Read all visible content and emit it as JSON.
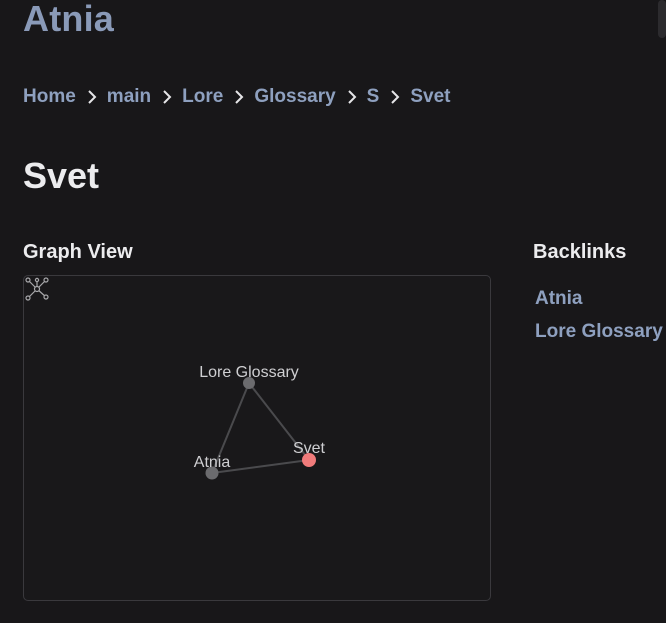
{
  "site": {
    "title": "Atnia"
  },
  "breadcrumb": [
    "Home",
    "main",
    "Lore",
    "Glossary",
    "S",
    "Svet"
  ],
  "page": {
    "title": "Svet"
  },
  "graph": {
    "heading": "Graph View",
    "nodes": [
      {
        "label": "Lore Glossary",
        "current": false
      },
      {
        "label": "Atnia",
        "current": false
      },
      {
        "label": "Svet",
        "current": true
      }
    ],
    "edges": [
      [
        "Lore Glossary",
        "Atnia"
      ],
      [
        "Lore Glossary",
        "Svet"
      ],
      [
        "Atnia",
        "Svet"
      ]
    ],
    "colors": {
      "node": "#6b6b6e",
      "current_node": "#f07b7b",
      "edge": "#4a4a4d"
    },
    "global_graph_icon": "global-graph-icon"
  },
  "backlinks": {
    "heading": "Backlinks",
    "items": [
      "Atnia",
      "Lore Glossary"
    ]
  },
  "colors": {
    "background": "#181719",
    "link": "#8ea0bf",
    "title_accent": "#8a9ab8"
  }
}
